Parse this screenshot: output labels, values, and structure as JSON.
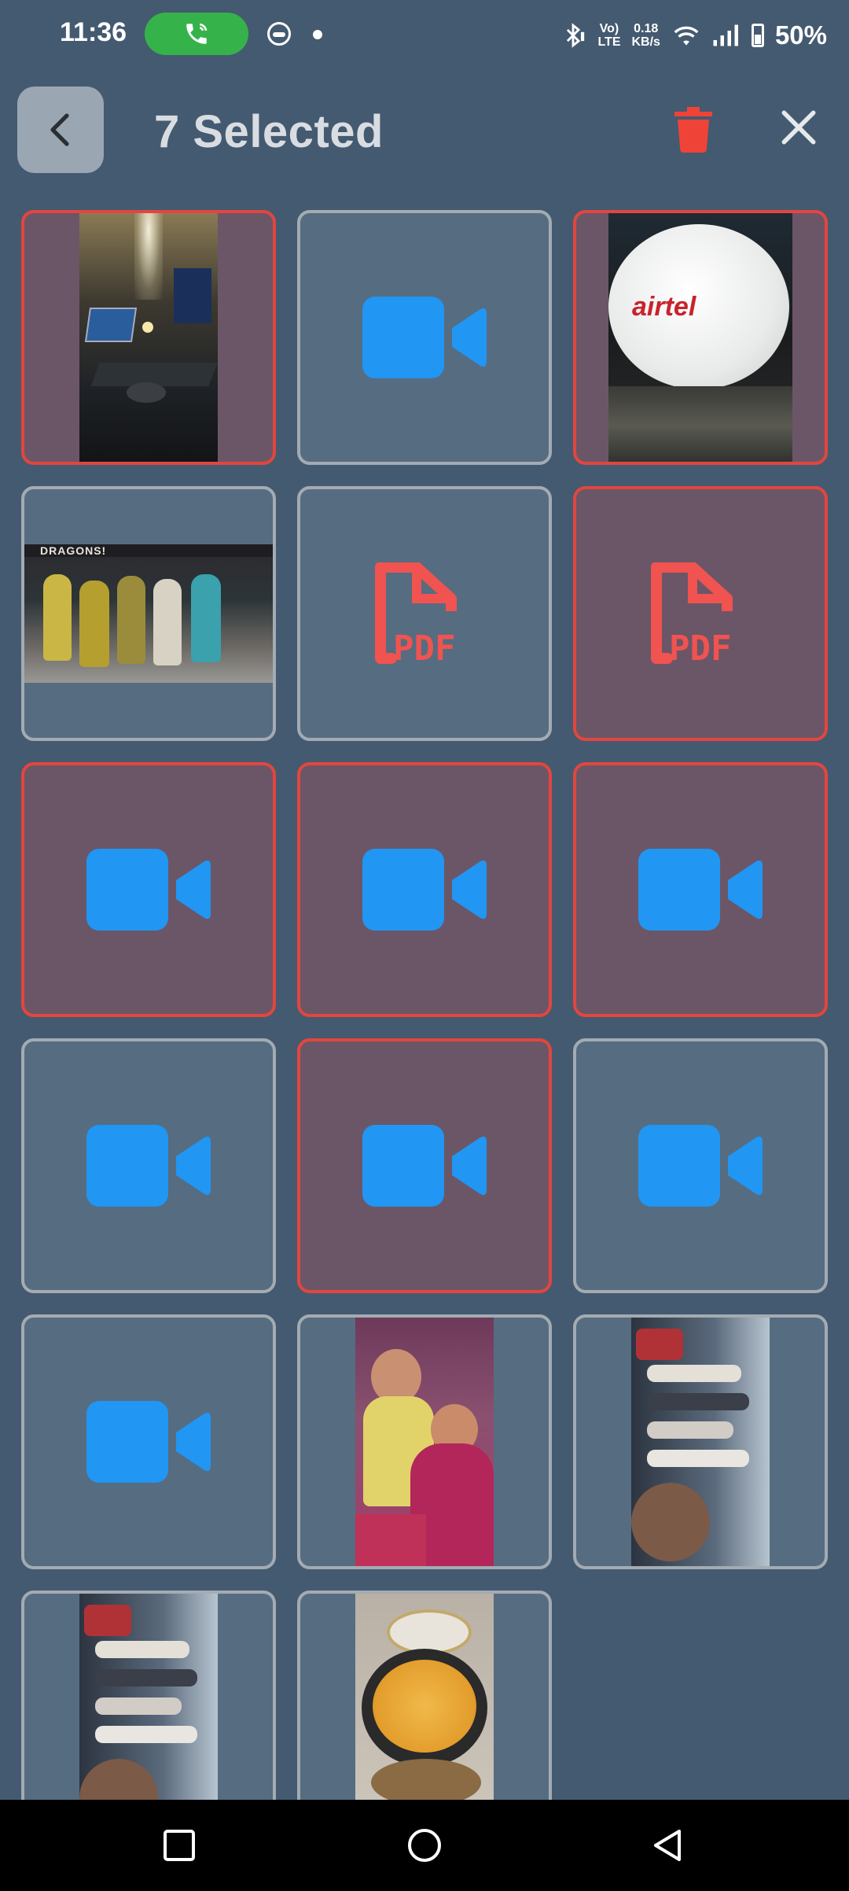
{
  "status_bar": {
    "time": "11:36",
    "network_speed_value": "0.18",
    "network_speed_unit": "KB/s",
    "volte_top": "Vo)",
    "volte_bottom": "LTE",
    "battery": "50%"
  },
  "header": {
    "title": "7 Selected"
  },
  "colors": {
    "selected_border": "#e2463e",
    "video_icon": "#2196f3",
    "pdf_icon": "#f05350",
    "delete_icon": "#f04337"
  },
  "tiles": [
    {
      "kind": "image",
      "selected": true,
      "desc": "desk-laptop-photo"
    },
    {
      "kind": "video",
      "selected": false
    },
    {
      "kind": "image",
      "selected": true,
      "desc": "airtel-dish-photo",
      "text": "airtel"
    },
    {
      "kind": "image",
      "selected": false,
      "desc": "group-holi-photo",
      "text": "DRAGONS!"
    },
    {
      "kind": "pdf",
      "selected": false,
      "text": "PDF"
    },
    {
      "kind": "pdf",
      "selected": true,
      "text": "PDF"
    },
    {
      "kind": "video",
      "selected": true
    },
    {
      "kind": "video",
      "selected": true
    },
    {
      "kind": "video",
      "selected": true
    },
    {
      "kind": "video",
      "selected": false
    },
    {
      "kind": "video",
      "selected": true
    },
    {
      "kind": "video",
      "selected": false
    },
    {
      "kind": "video",
      "selected": false
    },
    {
      "kind": "image",
      "selected": false,
      "desc": "mother-child-photo"
    },
    {
      "kind": "image",
      "selected": false,
      "desc": "group-selfie-photo"
    },
    {
      "kind": "image",
      "selected": false,
      "desc": "group-selfie-photo-2"
    },
    {
      "kind": "image",
      "selected": false,
      "desc": "pizza-photo"
    }
  ]
}
